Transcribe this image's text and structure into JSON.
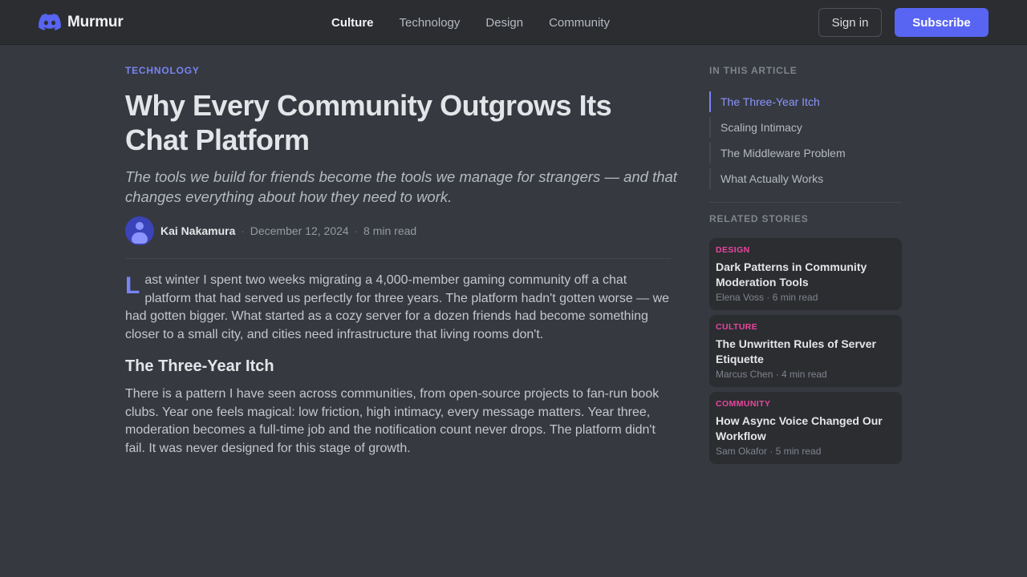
{
  "header": {
    "brand": "Murmur",
    "nav": [
      {
        "label": "Culture",
        "active": true
      },
      {
        "label": "Technology",
        "active": false
      },
      {
        "label": "Design",
        "active": false
      },
      {
        "label": "Community",
        "active": false
      }
    ],
    "signin_label": "Sign in",
    "subscribe_label": "Subscribe"
  },
  "article": {
    "category": "TECHNOLOGY",
    "title": "Why Every Community Outgrows Its Chat Platform",
    "subtitle": "The tools we build for friends become the tools we manage for strangers — and that changes everything about how they need to work.",
    "author": "Kai Nakamura",
    "date": "December 12, 2024",
    "read_time": "8 min read",
    "separator": "·",
    "intro_dropcap": "L",
    "intro_rest": "ast winter I spent two weeks migrating a 4,000-member gaming community off a chat platform that had served us perfectly for three years. The platform hadn't gotten worse — we had gotten bigger. What started as a cozy server for a dozen friends had become something closer to a small city, and cities need infrastructure that living rooms don't.",
    "section_heading": "The Three-Year Itch",
    "section_body": "There is a pattern I have seen across communities, from open-source projects to fan-run book clubs. Year one feels magical: low friction, high intimacy, every message matters. Year three, moderation becomes a full-time job and the notification count never drops. The platform didn't fail. It was never designed for this stage of growth."
  },
  "sidebar": {
    "toc_label": "IN THIS ARTICLE",
    "toc": [
      {
        "label": "The Three-Year Itch",
        "active": true
      },
      {
        "label": "Scaling Intimacy",
        "active": false
      },
      {
        "label": "The Middleware Problem",
        "active": false
      },
      {
        "label": "What Actually Works",
        "active": false
      }
    ],
    "related_label": "RELATED STORIES",
    "related": [
      {
        "category": "DESIGN",
        "title": "Dark Patterns in Community Moderation Tools",
        "meta": "Elena Voss · 6 min read"
      },
      {
        "category": "CULTURE",
        "title": "The Unwritten Rules of Server Etiquette",
        "meta": "Marcus Chen · 4 min read"
      },
      {
        "category": "COMMUNITY",
        "title": "How Async Voice Changed Our Workflow",
        "meta": "Sam Okafor · 5 min read"
      }
    ]
  },
  "colors": {
    "background": "#36393f",
    "header": "#2b2d31",
    "accent": "#5865f2",
    "accent_text": "#7984f5",
    "card_category": "#eb459e"
  },
  "icons": {
    "logo": "discord-logo-icon",
    "avatar": "user-avatar-icon"
  }
}
